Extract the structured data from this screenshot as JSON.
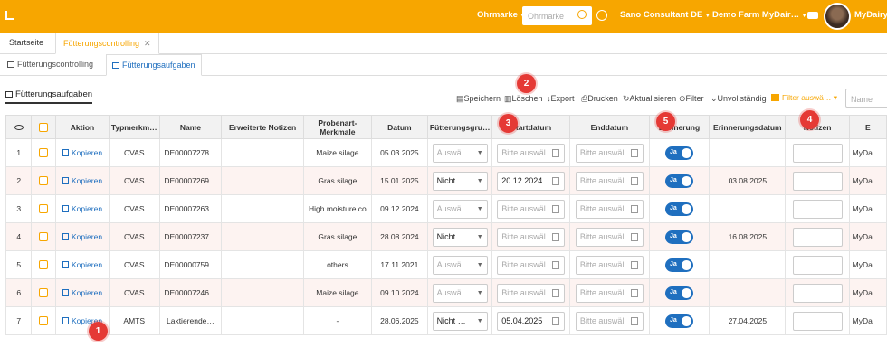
{
  "header": {
    "brand": "Ohrmarke",
    "search_placeholder": "Ohrmarke",
    "consultant": "Sano Consultant DE",
    "farm": "Demo Farm MyDair…",
    "app_name": "MyDairy"
  },
  "tabs_top": [
    {
      "label": "Startseite"
    },
    {
      "label": "Fütterungscontrolling"
    }
  ],
  "tabs_sub": [
    {
      "label": "Fütterungscontrolling"
    },
    {
      "label": "Fütterungsaufgaben"
    }
  ],
  "section_title": "Fütterungsaufgaben",
  "toolbar": {
    "save": "Speichern",
    "delete": "Löschen",
    "export": "Export",
    "print": "Drucken",
    "refresh": "Aktualisieren",
    "filter": "Filter",
    "incomplete": "Unvollständig",
    "filter_select": "Filter auswä…",
    "name_placeholder": "Name"
  },
  "columns": [
    "Aktion",
    "Typmerkm…",
    "Name",
    "Erweiterte Notizen",
    "Probenart-Merkmale",
    "Datum",
    "Fütterungsgru…",
    "Startdatum",
    "Enddatum",
    "Erinnerung",
    "Erinnerungsdatum",
    "Notizen",
    "E"
  ],
  "rows": [
    {
      "num": "1",
      "action": "Kopieren",
      "typ": "CVAS",
      "name": "DE00007278…",
      "notes_ext": "",
      "probenart": "Maize silage",
      "datum": "05.03.2025",
      "gruppe": "Auswä…",
      "gruppe_ph": true,
      "start": "Bitte auswäl",
      "start_ph": true,
      "end": "Bitte auswäl",
      "reminder": "Ja",
      "reminder_date": "",
      "farm": "MyDa"
    },
    {
      "num": "2",
      "action": "Kopieren",
      "typ": "CVAS",
      "name": "DE00007269…",
      "notes_ext": "",
      "probenart": "Gras silage",
      "datum": "15.01.2025",
      "gruppe": "Nicht …",
      "gruppe_ph": false,
      "start": "20.12.2024",
      "start_ph": false,
      "end": "Bitte auswäl",
      "reminder": "Ja",
      "reminder_date": "03.08.2025",
      "farm": "MyDa"
    },
    {
      "num": "3",
      "action": "Kopieren",
      "typ": "CVAS",
      "name": "DE00007263…",
      "notes_ext": "",
      "probenart": "High moisture co",
      "datum": "09.12.2024",
      "gruppe": "Auswä…",
      "gruppe_ph": true,
      "start": "Bitte auswäl",
      "start_ph": true,
      "end": "Bitte auswäl",
      "reminder": "Ja",
      "reminder_date": "",
      "farm": "MyDa"
    },
    {
      "num": "4",
      "action": "Kopieren",
      "typ": "CVAS",
      "name": "DE00007237…",
      "notes_ext": "",
      "probenart": "Gras silage",
      "datum": "28.08.2024",
      "gruppe": "Nicht …",
      "gruppe_ph": false,
      "start": "Bitte auswäl",
      "start_ph": true,
      "end": "Bitte auswäl",
      "reminder": "Ja",
      "reminder_date": "16.08.2025",
      "farm": "MyDa"
    },
    {
      "num": "5",
      "action": "Kopieren",
      "typ": "CVAS",
      "name": "DE00000759…",
      "notes_ext": "",
      "probenart": "others",
      "datum": "17.11.2021",
      "gruppe": "Auswä…",
      "gruppe_ph": true,
      "start": "Bitte auswäl",
      "start_ph": true,
      "end": "Bitte auswäl",
      "reminder": "Ja",
      "reminder_date": "",
      "farm": "MyDa"
    },
    {
      "num": "6",
      "action": "Kopieren",
      "typ": "CVAS",
      "name": "DE00007246…",
      "notes_ext": "",
      "probenart": "Maize silage",
      "datum": "09.10.2024",
      "gruppe": "Auswä…",
      "gruppe_ph": true,
      "start": "Bitte auswäl",
      "start_ph": true,
      "end": "Bitte auswäl",
      "reminder": "Ja",
      "reminder_date": "",
      "farm": "MyDa"
    },
    {
      "num": "7",
      "action": "Kopieren",
      "typ": "AMTS",
      "name": "Laktierende…",
      "notes_ext": "",
      "probenart": "-",
      "datum": "28.06.2025",
      "gruppe": "Nicht …",
      "gruppe_ph": false,
      "start": "05.04.2025",
      "start_ph": false,
      "end": "Bitte auswäl",
      "reminder": "Ja",
      "reminder_date": "27.04.2025",
      "farm": "MyDa"
    }
  ],
  "badges": [
    "1",
    "2",
    "3",
    "4",
    "5"
  ],
  "colors": {
    "accent": "#f7a600",
    "link": "#1f6fbf",
    "badge": "#e53935",
    "row_alt": "#fdf3f1"
  }
}
